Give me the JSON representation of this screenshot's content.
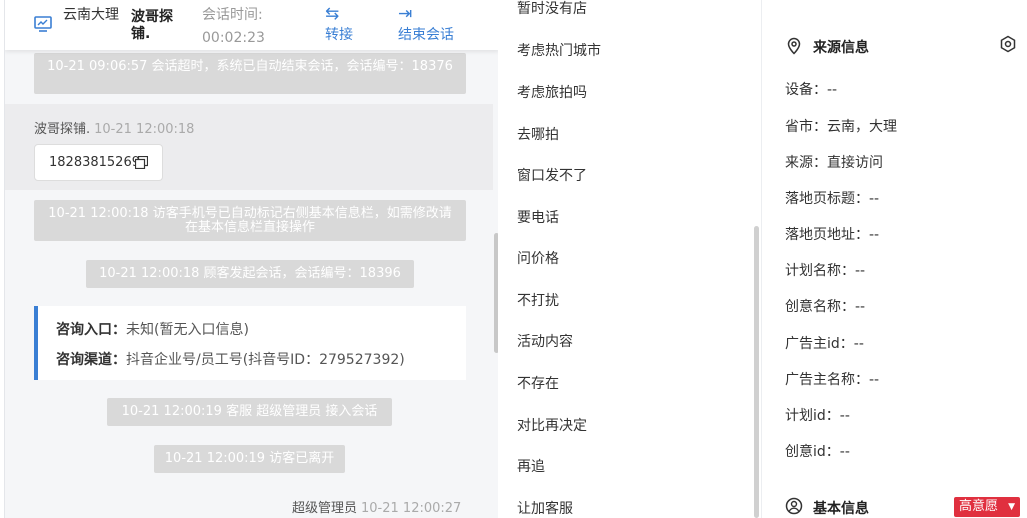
{
  "chat": {
    "header": {
      "location": "云南大理",
      "visitor": "波哥探铺.",
      "time_label": "会话时间:",
      "time": "00:02:23",
      "transfer": "转接",
      "end": "结束会话"
    },
    "sys1": "10-21 09:06:57 会话超时，系统已自动结束会话，会话编号：18376",
    "msg": {
      "sender": "波哥探铺.",
      "time": "10-21 12:00:18",
      "phone": "18283815269"
    },
    "sys2": "10-21 12:00:18 访客手机号已自动标记右侧基本信息栏，如需修改请在基本信息栏直接操作",
    "sys3": "10-21 12:00:18 顾客发起会话，会话编号：18396",
    "card": {
      "entry_label": "咨询入口：",
      "entry_value": "未知(暂无入口信息)",
      "channel_label": "咨询渠道：",
      "channel_value": "抖音企业号/员工号(抖音号ID：279527392)"
    },
    "sys4": "10-21 12:00:19 客服 超级管理员 接入会话",
    "sys5": "10-21 12:00:19 访客已离开",
    "last": {
      "sender": "超级管理员",
      "time": "10-21 12:00:27"
    }
  },
  "quick_replies": [
    "暂时没有店",
    "考虑热门城市",
    "考虑旅拍吗",
    "去哪拍",
    "窗口发不了",
    "要电话",
    "问价格",
    "不打扰",
    "活动内容",
    "不存在",
    "对比再决定",
    "再追",
    "让加客服"
  ],
  "source": {
    "title": "来源信息",
    "device": "设备：--",
    "province": "省市：云南，大理",
    "origin": "来源：直接访问",
    "landing_title": "落地页标题：--",
    "landing_url": "落地页地址：--",
    "plan_name": "计划名称：--",
    "creative_name": "创意名称：--",
    "advertiser_id": "广告主id：--",
    "advertiser_name": "广告主名称：--",
    "plan_id": "计划id：--",
    "creative_id": "创意id：--"
  },
  "basic": {
    "title": "基本信息",
    "intent": "高意愿"
  },
  "colors": {
    "accent": "#3a7fd4",
    "badge": "#e0303f",
    "system_msg": "#d9d9d9"
  }
}
